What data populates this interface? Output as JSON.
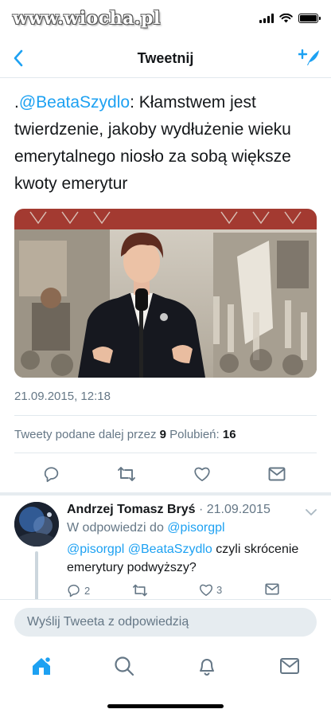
{
  "status_bar": {
    "watermark": "www.wiocha.pl"
  },
  "nav": {
    "title": "Tweetnij"
  },
  "tweet": {
    "prefix": ".",
    "mention": "@BeataSzydlo",
    "text": ": Kłamstwem jest twierdzenie, jakoby wydłużenie wieku emerytalnego niosło za sobą większe kwoty emerytur",
    "timestamp": "21.09.2015, 12:18",
    "retweets_label": "Tweety podane dalej przez",
    "retweets_count": "9",
    "likes_label": "Polubień:",
    "likes_count": "16"
  },
  "reply": {
    "name": "Andrzej Tomasz Bryś",
    "date": "· 21.09.2015",
    "reply_to_label": "W odpowiedzi do",
    "reply_to_handle": "@pisorgpl",
    "mention1": "@pisorgpl",
    "mention2": "@BeataSzydlo",
    "text": "czyli skrócenie emerytury podwyższy?",
    "reply_count": "2",
    "like_count": "3"
  },
  "composer": {
    "placeholder": "Wyślij Tweeta z odpowiedzią"
  },
  "colors": {
    "accent": "#1da1f2",
    "text": "#14171a",
    "muted": "#657786",
    "border": "#e1e8ed"
  },
  "icons": {
    "nav": [
      "back-chevron-icon",
      "compose-tweet-icon"
    ],
    "actions": [
      "comment-icon",
      "retweet-icon",
      "heart-icon",
      "share-envelope-icon"
    ],
    "tabs": [
      "home-icon",
      "search-icon",
      "bell-icon",
      "mail-icon"
    ]
  }
}
